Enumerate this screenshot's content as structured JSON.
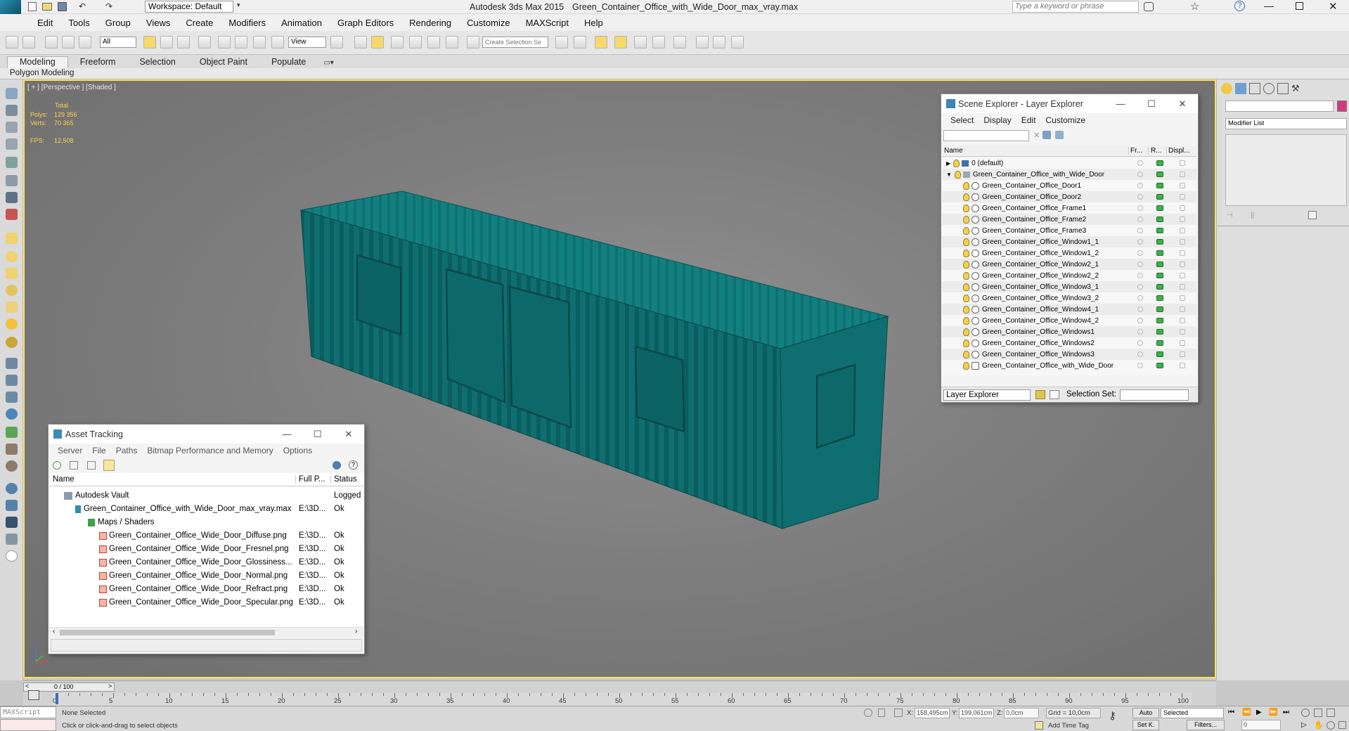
{
  "title": {
    "app": "Autodesk 3ds Max  2015",
    "file": "Green_Container_Office_with_Wide_Door_max_vray.max",
    "workspace": "Workspace: Default",
    "search_placeholder": "Type a keyword or phrase"
  },
  "menu": [
    "Edit",
    "Tools",
    "Group",
    "Views",
    "Create",
    "Modifiers",
    "Animation",
    "Graph Editors",
    "Rendering",
    "Customize",
    "MAXScript",
    "Help"
  ],
  "toolbar": {
    "selection_filter": "All",
    "ref_coord": "View",
    "named_sel": "Create Selection Se"
  },
  "ribbon": {
    "tabs": [
      "Modeling",
      "Freeform",
      "Selection",
      "Object Paint",
      "Populate"
    ],
    "sub_label": "Polygon Modeling"
  },
  "viewport": {
    "label": "[ + ] [Perspective ] [Shaded ]",
    "stats": {
      "total": "Total",
      "polys_label": "Polys:",
      "polys": "129 356",
      "verts_label": "Verts:",
      "verts": "70 365",
      "fps_label": "FPS:",
      "fps": "12,508"
    }
  },
  "scene_explorer": {
    "title": "Scene Explorer - Layer Explorer",
    "menu": [
      "Select",
      "Display",
      "Edit",
      "Customize"
    ],
    "columns": [
      "Name",
      "Fr...",
      "R...",
      "Displ..."
    ],
    "rows": [
      "0 (default)",
      "Green_Container_Office_with_Wide_Door",
      "Green_Container_Office_Door1",
      "Green_Container_Office_Door2",
      "Green_Container_Office_Frame1",
      "Green_Container_Office_Frame2",
      "Green_Container_Office_Frame3",
      "Green_Container_Office_Window1_1",
      "Green_Container_Office_Window1_2",
      "Green_Container_Office_Window2_1",
      "Green_Container_Office_Window2_2",
      "Green_Container_Office_Window3_1",
      "Green_Container_Office_Window3_2",
      "Green_Container_Office_Window4_1",
      "Green_Container_Office_Window4_2",
      "Green_Container_Office_Windows1",
      "Green_Container_Office_Windows2",
      "Green_Container_Office_Windows3",
      "Green_Container_Office_with_Wide_Door"
    ],
    "footer_mode": "Layer Explorer",
    "selection_set_label": "Selection Set:"
  },
  "asset_tracking": {
    "title": "Asset Tracking",
    "menu": [
      "Server",
      "File",
      "Paths",
      "Bitmap Performance and Memory",
      "Options"
    ],
    "columns": [
      "Name",
      "Full P...",
      "Status"
    ],
    "rows": [
      {
        "name": "Autodesk Vault",
        "path": "",
        "status": "Logged"
      },
      {
        "name": "Green_Container_Office_with_Wide_Door_max_vray.max",
        "path": "E:\\3D...",
        "status": "Ok"
      },
      {
        "name": "Maps / Shaders",
        "path": "",
        "status": ""
      },
      {
        "name": "Green_Container_Office_Wide_Door_Diffuse.png",
        "path": "E:\\3D...",
        "status": "Ok"
      },
      {
        "name": "Green_Container_Office_Wide_Door_Fresnel.png",
        "path": "E:\\3D...",
        "status": "Ok"
      },
      {
        "name": "Green_Container_Office_Wide_Door_Glossiness...",
        "path": "E:\\3D...",
        "status": "Ok"
      },
      {
        "name": "Green_Container_Office_Wide_Door_Normal.png",
        "path": "E:\\3D...",
        "status": "Ok"
      },
      {
        "name": "Green_Container_Office_Wide_Door_Refract.png",
        "path": "E:\\3D...",
        "status": "Ok"
      },
      {
        "name": "Green_Container_Office_Wide_Door_Specular.png",
        "path": "E:\\3D...",
        "status": "Ok"
      }
    ]
  },
  "command_panel": {
    "modifier_list": "Modifier List"
  },
  "timeline": {
    "frame": "0 / 100",
    "ticks": [
      "0",
      "5",
      "10",
      "15",
      "20",
      "25",
      "30",
      "35",
      "40",
      "45",
      "50",
      "55",
      "60",
      "65",
      "70",
      "75",
      "80",
      "85",
      "90",
      "95",
      "100"
    ]
  },
  "status": {
    "maxscript": "MAXScript",
    "none_selected": "None Selected",
    "hint": "Click or click-and-drag to select objects",
    "x_label": "X:",
    "x": "158,495cm",
    "y_label": "Y:",
    "y": "199,061cm",
    "z_label": "Z:",
    "z": "0,0cm",
    "grid": "Grid = 10,0cm",
    "auto": "Auto",
    "selected": "Selected",
    "set_key": "Set K.",
    "filters": "Filters...",
    "add_time_tag": "Add Time Tag",
    "frame_field": "0"
  },
  "colors": {
    "container": "#0d6b6b",
    "viewport_border": "#ffe25a",
    "stats": "#ffd24b"
  }
}
